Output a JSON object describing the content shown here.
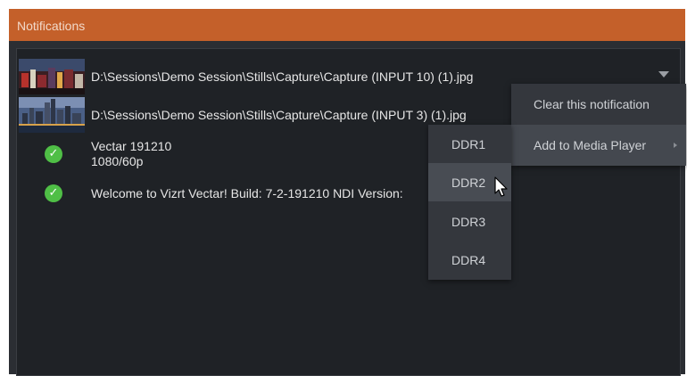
{
  "window": {
    "title": "Notifications"
  },
  "notifications": [
    {
      "type": "image",
      "path": "D:\\Sessions\\Demo Session\\Stills\\Capture\\Capture (INPUT 10) (1).jpg",
      "thumb_icon": "city-night-thumbnail"
    },
    {
      "type": "image",
      "path": "D:\\Sessions\\Demo Session\\Stills\\Capture\\Capture (INPUT 3) (1).jpg",
      "thumb_icon": "skyline-thumbnail"
    },
    {
      "type": "status",
      "icon": "check-circle-icon",
      "line1": "Vectar 191210",
      "line2": "1080/60p"
    },
    {
      "type": "status",
      "icon": "check-circle-icon",
      "line1": "Welcome to Vizrt Vectar! Build: 7-2-191210 NDI Version:"
    }
  ],
  "context_menu": {
    "items": [
      {
        "label": "Clear this notification"
      },
      {
        "label": "Add to Media Player",
        "has_submenu": true
      }
    ]
  },
  "submenu": {
    "items": [
      "DDR1",
      "DDR2",
      "DDR3",
      "DDR4"
    ],
    "hovered": "DDR2"
  },
  "colors": {
    "titlebar": "#c4602a",
    "panel": "#2b2e33",
    "list_bg": "#1f2226",
    "success": "#4fbf46"
  }
}
